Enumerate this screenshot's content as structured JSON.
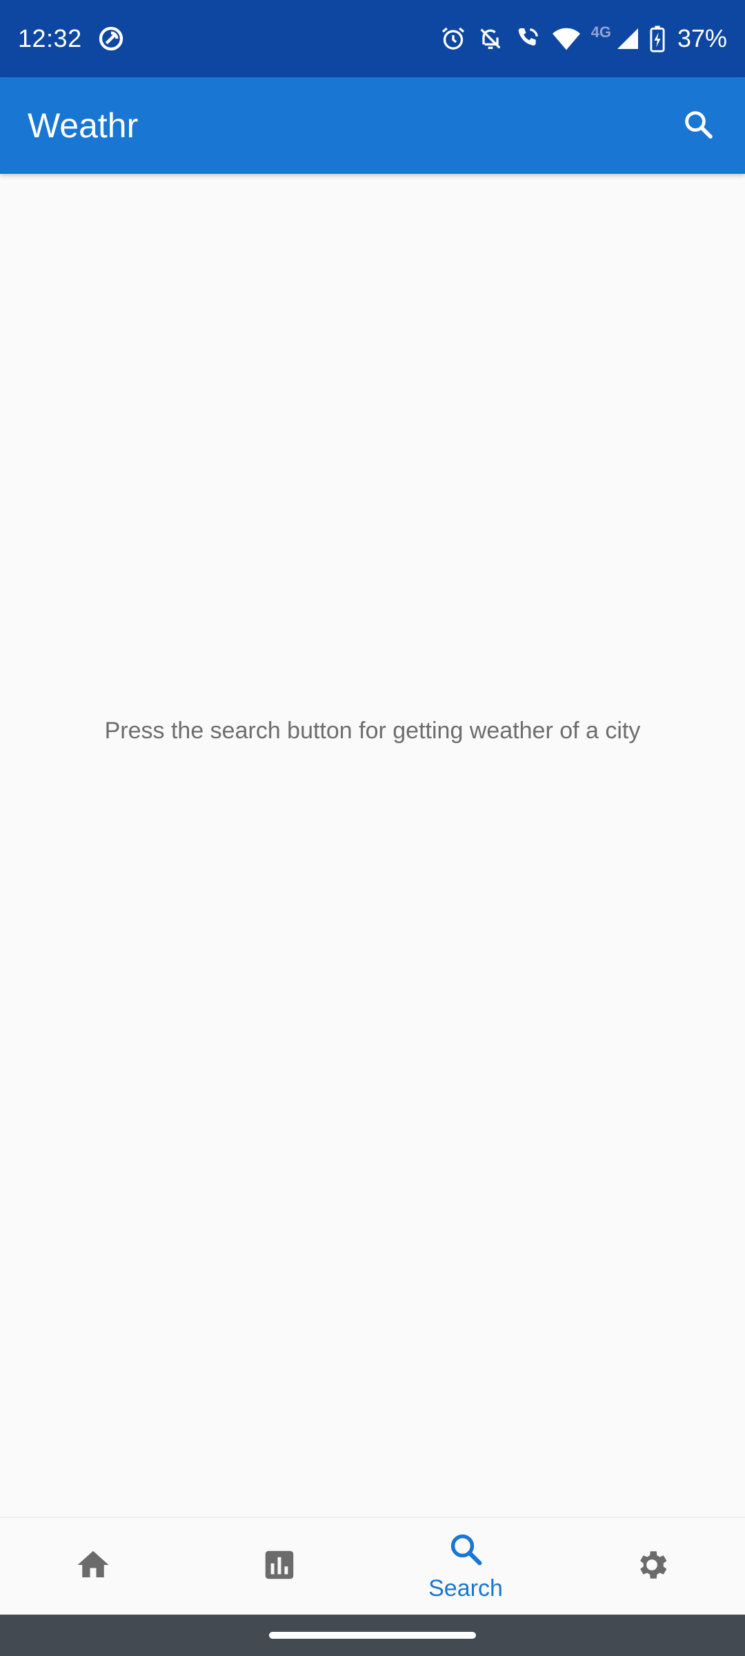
{
  "status_bar": {
    "time": "12:32",
    "network_type": "4G",
    "battery_percent": "37%",
    "icons": [
      "data-saver-icon",
      "alarm-icon",
      "notifications-off-icon",
      "wifi-calling-icon",
      "wifi-icon",
      "cell-signal-icon",
      "battery-charging-icon"
    ]
  },
  "app_bar": {
    "title": "Weathr",
    "search_icon": "search-icon"
  },
  "main": {
    "empty_message": "Press the search button for getting weather of a city"
  },
  "bottom_nav": {
    "items": [
      {
        "icon": "home-icon",
        "label": "",
        "selected": false
      },
      {
        "icon": "bar-chart-icon",
        "label": "",
        "selected": false
      },
      {
        "icon": "search-icon",
        "label": "Search",
        "selected": true
      },
      {
        "icon": "settings-icon",
        "label": "",
        "selected": false
      }
    ]
  },
  "colors": {
    "status_bar": "#0d47a1",
    "app_bar": "#1976d2",
    "accent": "#1976d2",
    "nav_icon_inactive": "#6b6b6b",
    "background": "#fafafa"
  }
}
